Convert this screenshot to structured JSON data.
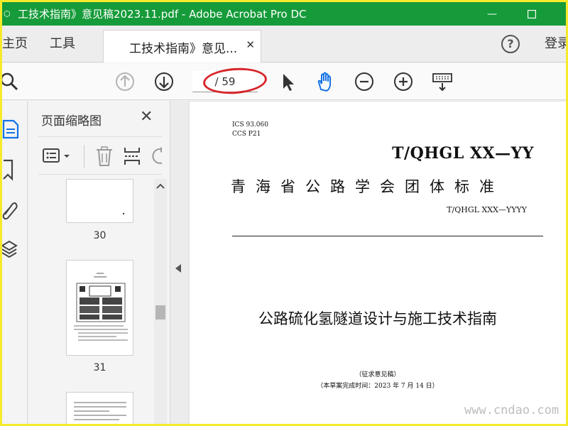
{
  "window": {
    "title": "工技术指南》意见稿2023.11.pdf - Adobe Acrobat Pro DC",
    "app_icon": "acrobat-icon",
    "minimize": "—",
    "maximize": "☐",
    "titlebar_color": "#169b3a",
    "frame_color": "#f7ea2a"
  },
  "tabs": {
    "home": "主页",
    "tools": "工具",
    "document": "工技术指南》意见...",
    "close": "✕",
    "help": "?",
    "login": "登录"
  },
  "toolbar": {
    "page_current": "",
    "page_total": "/ 59",
    "icons": [
      "search-icon",
      "page-up-icon",
      "page-down-icon",
      "select-cursor-icon",
      "hand-tool-icon",
      "zoom-out-icon",
      "zoom-in-icon",
      "keyboard-icon"
    ],
    "highlight_color": "#d8262b"
  },
  "rail": {
    "icons": [
      "thumbnails-icon",
      "bookmark-icon",
      "attachment-icon",
      "layers-icon"
    ]
  },
  "thumbnail_panel": {
    "title": "页面缩略图",
    "close": "✕",
    "tools": [
      "options-menu-icon",
      "delete-icon",
      "insert-page-icon",
      "rotate-icon"
    ],
    "pages": [
      {
        "number": "30"
      },
      {
        "number": "31"
      },
      {
        "number": ""
      }
    ]
  },
  "document": {
    "ics": "ICS  93.060",
    "ccs": "CCS P21",
    "standard_code": "T/QHGL XX—YY",
    "association": "青海省公路学会团体标准",
    "code_small": "T/QHGL XXX—YYYY",
    "title": "公路硫化氢隧道设计与施工技术指南",
    "draft": "（征求意见稿）",
    "completion_date": "（本草案完成时间：2023 年 7 月 14 日）"
  },
  "watermark": "www.cndao.com"
}
